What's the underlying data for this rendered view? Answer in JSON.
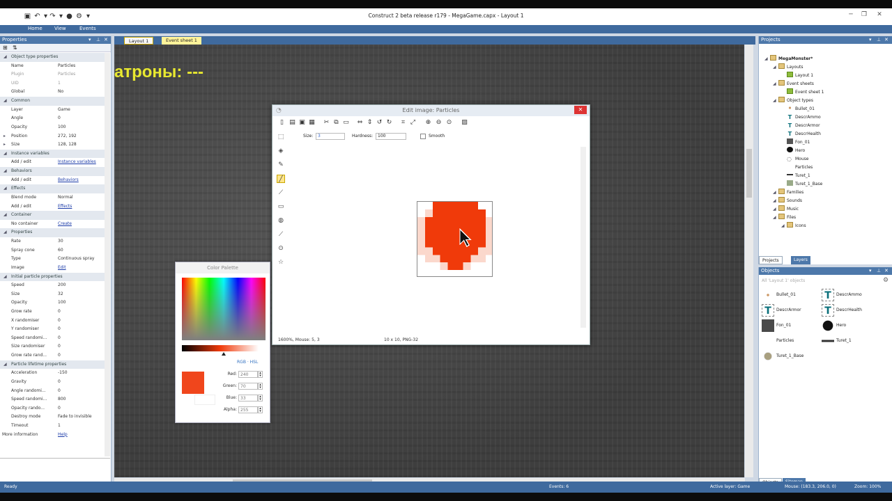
{
  "app": {
    "title": "Construct 2 beta release r179 - MegaGame.capx - Layout 1",
    "menus": [
      "Home",
      "View",
      "Events"
    ]
  },
  "properties": {
    "header": "Properties",
    "rows": [
      {
        "type": "sec",
        "name": "Object type properties"
      },
      {
        "name": "Name",
        "value": "Particles"
      },
      {
        "name": "Plugin",
        "value": "Particles",
        "grey": true
      },
      {
        "name": "UID",
        "value": "1",
        "grey": true
      },
      {
        "name": "Global",
        "value": "No"
      },
      {
        "type": "sec",
        "name": "Common"
      },
      {
        "name": "Layer",
        "value": "Game"
      },
      {
        "name": "Angle",
        "value": "0"
      },
      {
        "name": "Opacity",
        "value": "100"
      },
      {
        "name": "Position",
        "value": "272, 192",
        "exp": true
      },
      {
        "name": "Size",
        "value": "128, 128",
        "exp": true
      },
      {
        "type": "sec",
        "name": "Instance variables"
      },
      {
        "name": "Add / edit",
        "value": "Instance variables",
        "link": true
      },
      {
        "type": "sec",
        "name": "Behaviors"
      },
      {
        "name": "Add / edit",
        "value": "Behaviors",
        "link": true
      },
      {
        "type": "sec",
        "name": "Effects"
      },
      {
        "name": "Blend mode",
        "value": "Normal"
      },
      {
        "name": "Add / edit",
        "value": "Effects",
        "link": true
      },
      {
        "type": "sec",
        "name": "Container"
      },
      {
        "name": "No container",
        "value": "Create",
        "link": true
      },
      {
        "type": "sec",
        "name": "Properties"
      },
      {
        "name": "Rate",
        "value": "30"
      },
      {
        "name": "Spray cone",
        "value": "60"
      },
      {
        "name": "Type",
        "value": "Continuous spray"
      },
      {
        "name": "Image",
        "value": "Edit",
        "link": true
      },
      {
        "type": "sec",
        "name": "Initial particle properties"
      },
      {
        "name": "Speed",
        "value": "200"
      },
      {
        "name": "Size",
        "value": "32"
      },
      {
        "name": "Opacity",
        "value": "100"
      },
      {
        "name": "Grow rate",
        "value": "0"
      },
      {
        "name": "X randomiser",
        "value": "0"
      },
      {
        "name": "Y randomiser",
        "value": "0"
      },
      {
        "name": "Speed randomi...",
        "value": "0"
      },
      {
        "name": "Size randomiser",
        "value": "0"
      },
      {
        "name": "Grow rate rand...",
        "value": "0"
      },
      {
        "type": "sec",
        "name": "Particle lifetime properties"
      },
      {
        "name": "Acceleration",
        "value": "-150"
      },
      {
        "name": "Gravity",
        "value": "0"
      },
      {
        "name": "Angle randomi...",
        "value": "0"
      },
      {
        "name": "Speed randomi...",
        "value": "800"
      },
      {
        "name": "Opacity rando...",
        "value": "0"
      },
      {
        "name": "Destroy mode",
        "value": "Fade to invisible"
      },
      {
        "name": "Timeout",
        "value": "1"
      },
      {
        "name": "More information",
        "value": "Help",
        "link": true,
        "flush": true
      }
    ]
  },
  "tabs": [
    "Layout 1",
    "Event sheet 1"
  ],
  "canvas_text": "атроны: ---",
  "editor": {
    "title": "Edit image: Particles",
    "size_label": "Size:",
    "size_value": "3",
    "hardness_label": "Hardness:",
    "hardness_value": "100",
    "smooth_label": "Smooth",
    "status_left": "1600%, Mouse: 5, 3",
    "status_mid": "10 x 10, PNG-32",
    "pixel_color": "#f03a0a"
  },
  "palette": {
    "title": "Color Palette",
    "mode": "RGB · HSL",
    "channels": [
      {
        "label": "Red:",
        "value": "240"
      },
      {
        "label": "Green:",
        "value": "70"
      },
      {
        "label": "Blue:",
        "value": "33"
      },
      {
        "label": "Alpha:",
        "value": "255"
      }
    ],
    "swatch_color": "#f0461c"
  },
  "projects": {
    "header": "Projects",
    "items": [
      {
        "label": "MegaMonster*",
        "icon": "project",
        "indent": 0,
        "bold": true
      },
      {
        "label": "Layouts",
        "icon": "folder",
        "indent": 1
      },
      {
        "label": "Layout 1",
        "icon": "green",
        "indent": 2
      },
      {
        "label": "Event sheets",
        "icon": "folder",
        "indent": 1
      },
      {
        "label": "Event sheet 1",
        "icon": "green",
        "indent": 2
      },
      {
        "label": "Object types",
        "icon": "folder",
        "indent": 1
      },
      {
        "label": "Bullet_01",
        "icon": "dot",
        "indent": 2
      },
      {
        "label": "DescrAmmo",
        "icon": "text",
        "indent": 2
      },
      {
        "label": "DescrArmor",
        "icon": "text",
        "indent": 2
      },
      {
        "label": "DescrHealth",
        "icon": "text",
        "indent": 2
      },
      {
        "label": "Fon_01",
        "icon": "dark",
        "indent": 2
      },
      {
        "label": "Hero",
        "icon": "blob",
        "indent": 2
      },
      {
        "label": "Mouse",
        "icon": "mouse",
        "indent": 2
      },
      {
        "label": "Particles",
        "icon": "none",
        "indent": 2
      },
      {
        "label": "Turet_1",
        "icon": "gun",
        "indent": 2
      },
      {
        "label": "Turet_1_Base",
        "icon": "base",
        "indent": 2
      },
      {
        "label": "Families",
        "icon": "folder",
        "indent": 1
      },
      {
        "label": "Sounds",
        "icon": "folder",
        "indent": 1
      },
      {
        "label": "Music",
        "icon": "folder",
        "indent": 1
      },
      {
        "label": "Files",
        "icon": "folder",
        "indent": 1
      },
      {
        "label": "Icons",
        "icon": "folder",
        "indent": 2
      }
    ],
    "bottom_tabs": [
      "Projects",
      "Layers"
    ]
  },
  "objects": {
    "header": "Objects",
    "filter_placeholder": "All 'Layout 1' objects",
    "items": [
      {
        "label": "Bullet_01",
        "icon": "dot"
      },
      {
        "label": "DescrAmmo",
        "icon": "text"
      },
      {
        "label": "DescrArmor",
        "icon": "text"
      },
      {
        "label": "DescrHealth",
        "icon": "text"
      },
      {
        "label": "Fon_01",
        "icon": "dark"
      },
      {
        "label": "Hero",
        "icon": "blob"
      },
      {
        "label": "Particles",
        "icon": "none"
      },
      {
        "label": "Turet_1",
        "icon": "gun"
      },
      {
        "label": "Turet_1_Base",
        "icon": "base"
      }
    ],
    "bottom_tabs": [
      "Objects",
      "Sitemap"
    ]
  },
  "status": {
    "left": "Ready",
    "events": "Events: 6",
    "layer": "Active layer: Game",
    "mouse": "Mouse: (183.3, 206.0, 0)",
    "zoom": "Zoom: 100%"
  }
}
